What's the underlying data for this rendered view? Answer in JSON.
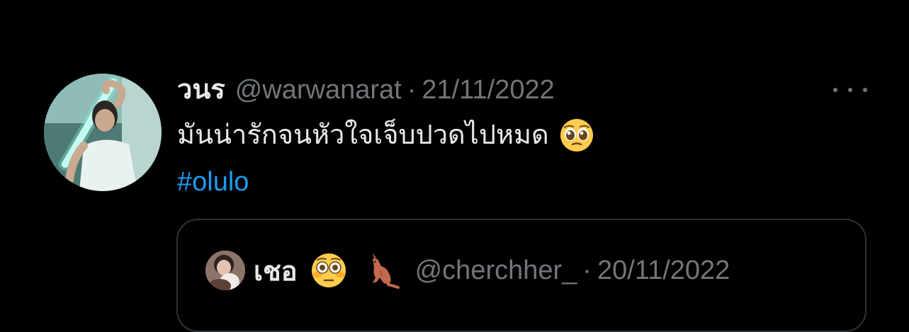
{
  "tweet": {
    "author": {
      "display_name": "วนร",
      "handle": "@warwanarat",
      "avatar": "profile-photo"
    },
    "separator": "·",
    "date": "21/11/2022",
    "more_icon": "more-horizontal-icon",
    "text": "มันน่ารักจนหัวใจเจ็บปวดไปหมด",
    "emoji": "pleading-face-emoji",
    "hashtag": "#olulo"
  },
  "quoted_tweet": {
    "author": {
      "display_name": "เชอ",
      "handle": "@cherchher_",
      "avatar": "profile-photo"
    },
    "emojis": [
      "flushed-face-emoji",
      "kangaroo-emoji"
    ],
    "separator": "·",
    "date": "20/11/2022"
  },
  "colors": {
    "background": "#000000",
    "primary_text": "#e7e9ea",
    "secondary_text": "#71767b",
    "link": "#1d9bf0",
    "border": "#2f3336"
  }
}
